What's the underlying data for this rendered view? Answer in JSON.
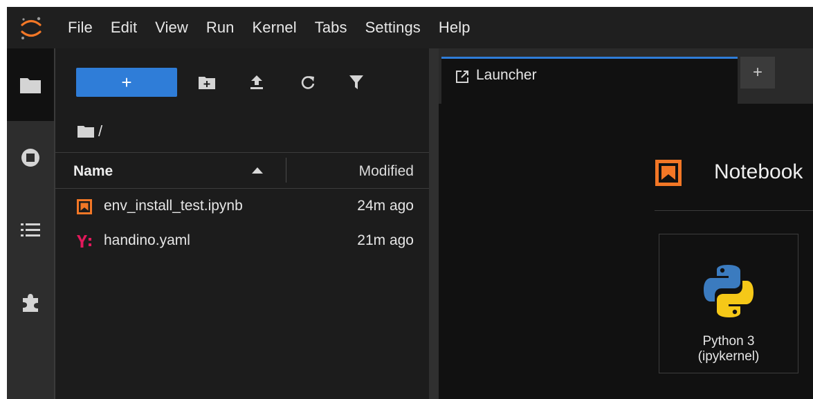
{
  "menubar": {
    "logo": "jupyter-logo-icon",
    "items": [
      "File",
      "Edit",
      "View",
      "Run",
      "Kernel",
      "Tabs",
      "Settings",
      "Help"
    ]
  },
  "sidebar": {
    "icons": [
      "folder-icon",
      "running-icon",
      "toc-icon",
      "extension-icon"
    ],
    "active": "folder-icon"
  },
  "file_browser": {
    "new_label": "+",
    "toolbar": [
      "new-folder-icon",
      "upload-icon",
      "refresh-icon",
      "filter-icon"
    ],
    "breadcrumb": "/",
    "columns": {
      "name": "Name",
      "modified": "Modified"
    },
    "files": [
      {
        "name": "env_install_test.ipynb",
        "modified": "24m ago",
        "icon": "notebook-icon"
      },
      {
        "name": "handino.yaml",
        "modified": "21m ago",
        "icon": "yaml-icon"
      }
    ]
  },
  "main": {
    "tabs": [
      {
        "label": "Launcher",
        "icon": "launcher-icon"
      }
    ],
    "add_tab_label": "+",
    "section": {
      "title": "Notebook",
      "icon": "notebook-section-icon"
    },
    "kernel_card": {
      "line1": "Python 3",
      "line2": "(ipykernel)",
      "icon": "python-logo-icon"
    }
  },
  "colors": {
    "accent": "#2f7dd8",
    "notebook_orange": "#f37726",
    "yaml_pink": "#e2195b",
    "python_blue": "#3b7bbf",
    "python_yellow": "#f5c818"
  }
}
